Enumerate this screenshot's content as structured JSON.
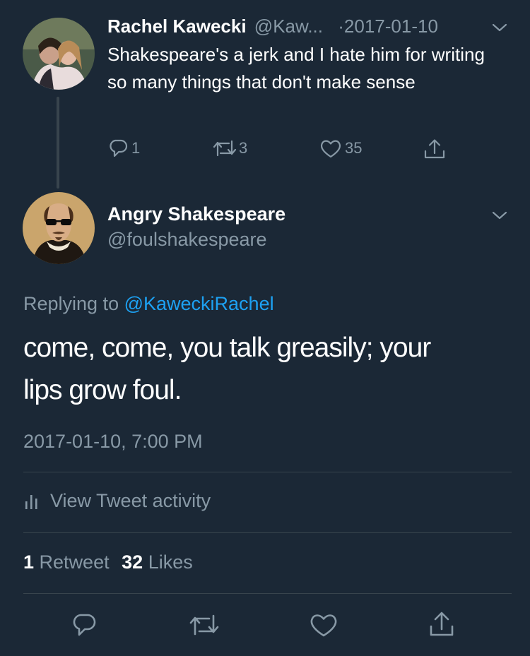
{
  "parent_tweet": {
    "author_name": "Rachel Kawecki",
    "author_handle": "@Kaw...",
    "date": "·2017-01-10",
    "text": "Shakespeare's a jerk and I hate him for writing so many things that don't make sense",
    "actions": {
      "replies": "1",
      "retweets": "3",
      "likes": "35"
    }
  },
  "main_tweet": {
    "author_name": "Angry Shakespeare",
    "author_handle": "@foulshakespeare",
    "replying_prefix": "Replying to ",
    "replying_handle": "@KaweckiRachel",
    "text_line1": "come, come, you talk greasily; your",
    "text_line2": "lips grow foul.",
    "timestamp": "2017-01-10, 7:00 PM",
    "activity_label": "View Tweet activity",
    "stats": {
      "retweet_count": "1",
      "retweet_label": "Retweet",
      "like_count": "32",
      "like_label": "Likes"
    }
  },
  "colors": {
    "background": "#1b2836",
    "text_primary": "#ffffff",
    "text_secondary": "#8899a6",
    "accent": "#1da1f2",
    "divider": "#38444d"
  },
  "icons": [
    "reply-icon",
    "retweet-icon",
    "like-icon",
    "share-icon",
    "chevron-down-icon",
    "activity-icon"
  ]
}
